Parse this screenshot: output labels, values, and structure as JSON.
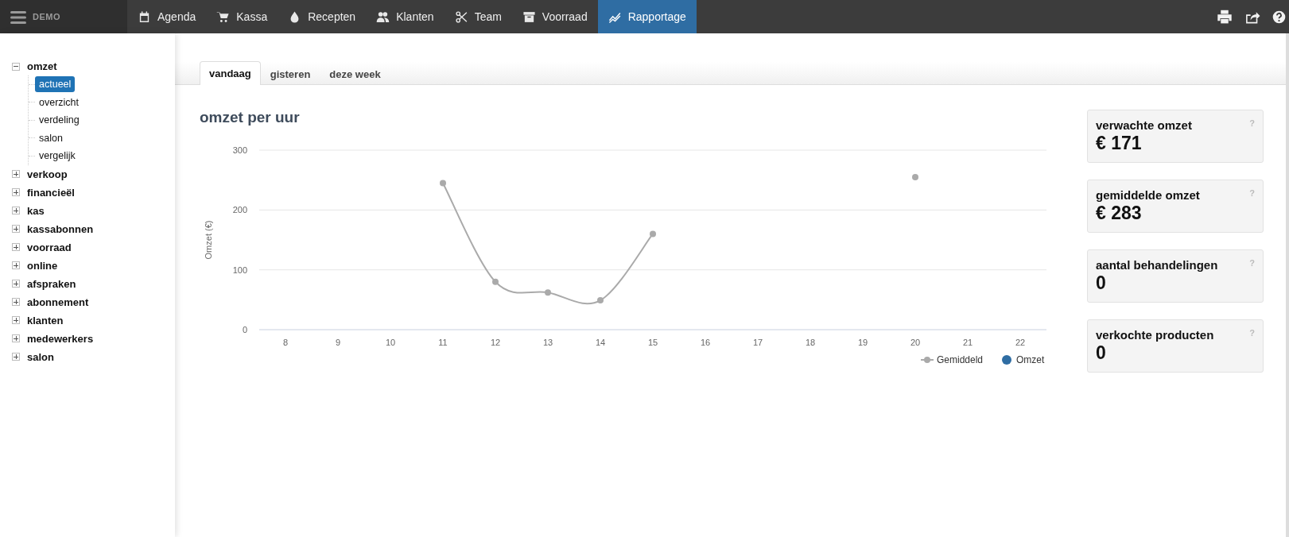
{
  "app": {
    "menu_label": "DEMO"
  },
  "nav": [
    {
      "label": "Agenda",
      "selected": false
    },
    {
      "label": "Kassa",
      "selected": false
    },
    {
      "label": "Recepten",
      "selected": false
    },
    {
      "label": "Klanten",
      "selected": false
    },
    {
      "label": "Team",
      "selected": false
    },
    {
      "label": "Voorraad",
      "selected": false
    },
    {
      "label": "Rapportage",
      "selected": true
    }
  ],
  "sidebar": {
    "items": [
      {
        "label": "omzet",
        "expanded": true,
        "children": [
          {
            "label": "actueel",
            "selected": true
          },
          {
            "label": "overzicht",
            "selected": false
          },
          {
            "label": "verdeling",
            "selected": false
          },
          {
            "label": "salon",
            "selected": false
          },
          {
            "label": "vergelijk",
            "selected": false
          }
        ]
      },
      {
        "label": "verkoop",
        "expanded": false
      },
      {
        "label": "financieël",
        "expanded": false
      },
      {
        "label": "kas",
        "expanded": false
      },
      {
        "label": "kassabonnen",
        "expanded": false
      },
      {
        "label": "voorraad",
        "expanded": false
      },
      {
        "label": "online",
        "expanded": false
      },
      {
        "label": "afspraken",
        "expanded": false
      },
      {
        "label": "abonnement",
        "expanded": false
      },
      {
        "label": "klanten",
        "expanded": false
      },
      {
        "label": "medewerkers",
        "expanded": false
      },
      {
        "label": "salon",
        "expanded": false
      }
    ]
  },
  "tabs": [
    {
      "label": "vandaag",
      "selected": true
    },
    {
      "label": "gisteren",
      "selected": false
    },
    {
      "label": "deze week",
      "selected": false
    }
  ],
  "chart": {
    "title": "omzet per uur",
    "chart_data": {
      "type": "line",
      "ylabel": "Omzet (€)",
      "categories": [
        "8",
        "9",
        "10",
        "11",
        "12",
        "13",
        "14",
        "15",
        "16",
        "17",
        "18",
        "19",
        "20",
        "21",
        "22"
      ],
      "ylim": [
        0,
        300
      ],
      "yticks": [
        0,
        100,
        200,
        300
      ],
      "series": [
        {
          "name": "Gemiddeld",
          "color": "#aaaaaa",
          "marker": "circle",
          "values": [
            null,
            null,
            null,
            245,
            80,
            62,
            49,
            160,
            null,
            null,
            null,
            null,
            255,
            null,
            null
          ]
        },
        {
          "name": "Omzet",
          "color": "#2f6da3",
          "values": [
            null,
            null,
            null,
            null,
            null,
            null,
            null,
            null,
            null,
            null,
            null,
            null,
            null,
            null,
            null
          ]
        }
      ]
    }
  },
  "cards": [
    {
      "label": "verwachte omzet",
      "value": "€ 171",
      "help": "?"
    },
    {
      "label": "gemiddelde omzet",
      "value": "€ 283",
      "help": "?"
    },
    {
      "label": "aantal behandelingen",
      "value": "0",
      "help": "?"
    },
    {
      "label": "verkochte producten",
      "value": "0",
      "help": "?"
    }
  ]
}
